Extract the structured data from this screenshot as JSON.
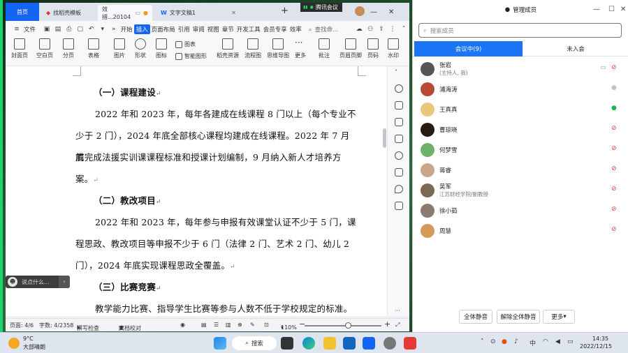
{
  "wps": {
    "tabs": {
      "home": "首页",
      "template": "找稻壳模板",
      "doc_partial": "效措...20104",
      "doc": "文字文稿1"
    },
    "tencent_badge": "腾讯会议",
    "menu": {
      "file": "文件",
      "start": "开始",
      "insert": "插入",
      "layout": "页面布局",
      "ref": "引用",
      "review": "审阅",
      "view": "视图",
      "chapter": "章节",
      "dev": "开发工具",
      "member": "会员专享",
      "efficiency": "效率",
      "search": "查找命..."
    },
    "ribbon": {
      "cover": "封面页",
      "blank": "空白页",
      "pagebreak": "分页",
      "table": "表格",
      "picture": "图片",
      "shape": "形状",
      "icon": "图标",
      "chart": "图表",
      "smartart": "智能图形",
      "docer": "稻壳资源",
      "flowchart": "流程图",
      "mindmap": "思维导图",
      "more": "更多",
      "comment": "批注",
      "headerfooter": "页眉页脚",
      "pagenum": "页码",
      "watermark": "水印"
    },
    "doc": {
      "h1": "（一）课程建设",
      "p1": [
        "2022 年和 2023 年，每年各建成在线课程 8 门以上（每个专业不",
        "少于 2 门），2024 年底全部核心课程均建成在线课程。2022 年 7 月底",
        "前完成法援实训课课程标准和授课计划编制，9 月纳入新人才培养方",
        "案。"
      ],
      "h2": "（二）教改项目",
      "p2": [
        "2022 年和 2023 年，每年参与申报有效课堂认证不少于 5 门，课",
        "程思政、教改项目等申报不少于 6 门（法律 2 门、艺术 2 门、幼儿 2",
        "门），2024 年底实现课程思政全覆盖。"
      ],
      "h3": "（三）比赛竞赛",
      "p3": "教学能力比赛、指导学生比赛等参与人数不低于学校规定的标准。"
    },
    "status": {
      "page": "页面: 4/6",
      "words": "字数: 4/2358",
      "spell": "拼写检查",
      "proof": "文档校对",
      "zoom": "110%"
    },
    "chat_placeholder": "说点什么..."
  },
  "panel": {
    "title": "管理成员",
    "search_placeholder": "搜索成员",
    "tab_in": "会议中(9)",
    "tab_out": "未入会",
    "members": [
      {
        "name": "张岩",
        "sub": "(主持人, 我)",
        "color": "#555",
        "mic": "muted"
      },
      {
        "name": "浦海涛",
        "sub": "",
        "color": "#b84a3a",
        "mic": "off"
      },
      {
        "name": "王真真",
        "sub": "",
        "color": "#e8c77a",
        "mic": "on"
      },
      {
        "name": "曹琼晓",
        "sub": "",
        "color": "#2a1a14",
        "mic": "muted"
      },
      {
        "name": "何梦雪",
        "sub": "",
        "color": "#6db36a",
        "mic": "muted"
      },
      {
        "name": "蒋睿",
        "sub": "",
        "color": "#c9a58a",
        "mic": "muted"
      },
      {
        "name": "吴军",
        "sub": "江苏财经学院/副教授",
        "color": "#7a6a55",
        "mic": "muted"
      },
      {
        "name": "徐小茹",
        "sub": "",
        "color": "#8a7a70",
        "mic": "muted"
      },
      {
        "name": "周慧",
        "sub": "",
        "color": "#d49a5a",
        "mic": "muted"
      }
    ],
    "btn_mute_all": "全体静音",
    "btn_unmute_all": "解除全体静音",
    "btn_more": "更多"
  },
  "taskbar": {
    "weather_temp": "9°C",
    "weather_desc": "大部晴朗",
    "search": "搜索",
    "ime": "中",
    "time": "14:35",
    "date": "2022/12/15"
  }
}
